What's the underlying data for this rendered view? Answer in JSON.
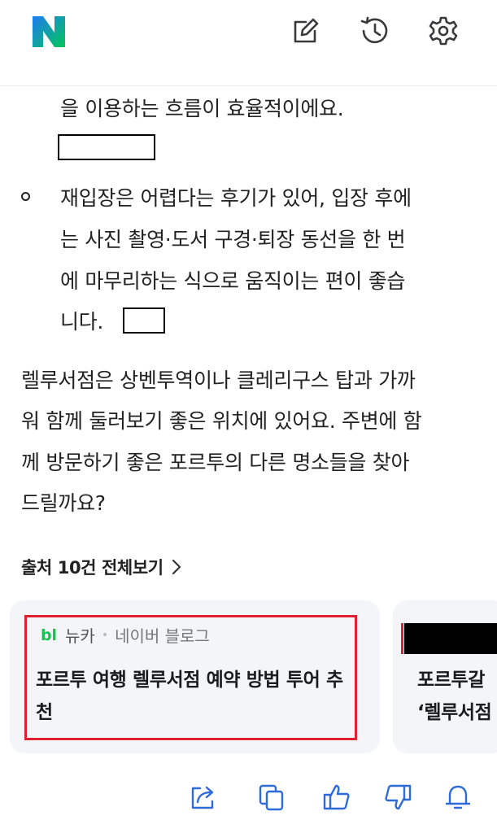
{
  "header": {
    "logo_letter": "N",
    "brand_color": "#03c75a",
    "brand_color_alt": "#1f7bf0",
    "icons": [
      "compose-icon",
      "history-icon",
      "settings-icon"
    ]
  },
  "answer": {
    "line_1": "을 이용하는 흐름이 효율적이에요.",
    "bullet_lines": [
      "재입장은 어렵다는 후기가 있어, 입장 후에",
      "는 사진 촬영·도서 구경·퇴장 동선을 한 번",
      "에 마무리하는 식으로 움직이는 편이 좋습",
      "니다."
    ],
    "paragraph_lines": [
      "렐루서점은 상벤투역이나 클레리구스 탑과 가까",
      "워 함께 둘러보기 좋은 위치에 있어요. 주변에 함",
      "께 방문하기 좋은 포르투의 다른 명소들을 찾아",
      "드릴까요?"
    ]
  },
  "sources": {
    "link_label": "출처 10건 전체보기",
    "cards": [
      {
        "badge": "bl",
        "source": "뉴카",
        "source_type": "네이버 블로그",
        "title": "포르투 여행 렐루서점 예약 방법 투어 추천"
      },
      {
        "title_line_1": "포르투갈",
        "title_line_2": "‘렐루서점"
      }
    ]
  },
  "actions": [
    "share-icon",
    "copy-icon",
    "thumbs-up-icon",
    "thumbs-down-icon",
    "bell-icon"
  ],
  "colors": {
    "highlight": "#e0202f",
    "card_bg": "#f3f5f9",
    "blog_green": "#19c14f"
  }
}
